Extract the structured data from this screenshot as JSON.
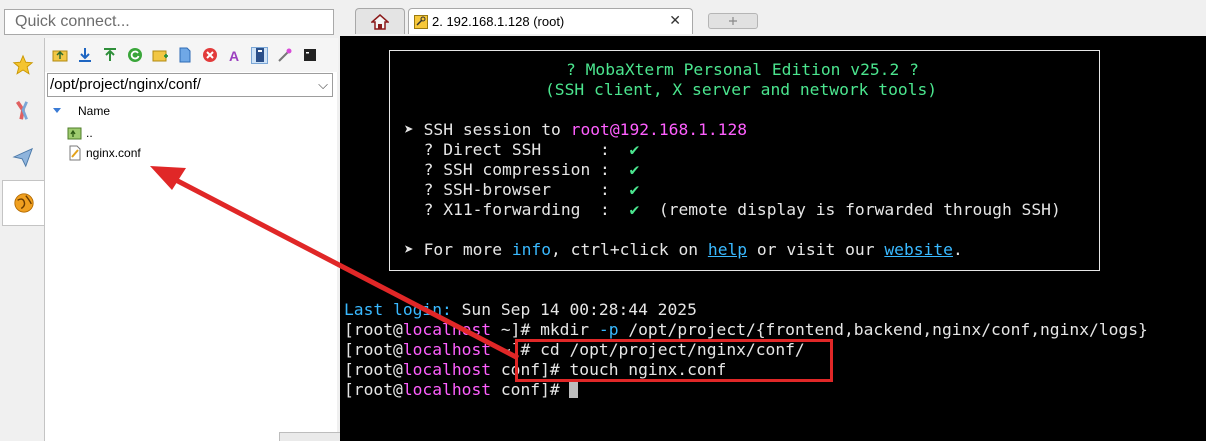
{
  "quick_connect": {
    "placeholder": "Quick connect..."
  },
  "side_tabs": [
    {
      "name": "favorites",
      "icon": "star-icon"
    },
    {
      "name": "tools",
      "icon": "tools-icon"
    },
    {
      "name": "sftp",
      "icon": "paper-plane-icon"
    },
    {
      "name": "sessions",
      "icon": "globe-icon"
    }
  ],
  "browser": {
    "toolbar_icons": [
      "parent-folder-icon",
      "download-icon",
      "upload-icon",
      "refresh-icon",
      "new-folder-icon",
      "new-file-icon",
      "delete-icon",
      "rename-icon",
      "follow-terminal-icon",
      "wand-icon",
      "terminal-icon"
    ],
    "path": "/opt/project/nginx/conf/",
    "column_name": "Name",
    "items": [
      {
        "label": "..",
        "icon": "parent-folder-icon"
      },
      {
        "label": "nginx.conf",
        "icon": "text-file-icon"
      }
    ]
  },
  "tabs": {
    "ssh_tab_label": "2. 192.168.1.128 (root)",
    "close_symbol": "✕"
  },
  "terminal": {
    "banner_title": "? MobaXterm Personal Edition v25.2 ?",
    "banner_subtitle": "(SSH client, X server and network tools)",
    "session_prefix": "➤ SSH session to ",
    "session_target": "root@192.168.1.128",
    "features": [
      {
        "label": "  ? Direct SSH      :  ",
        "value": "✔",
        "note": ""
      },
      {
        "label": "  ? SSH compression :  ",
        "value": "✔",
        "note": ""
      },
      {
        "label": "  ? SSH-browser     :  ",
        "value": "✔",
        "note": ""
      },
      {
        "label": "  ? X11-forwarding  :  ",
        "value": "✔",
        "note": "  (remote display is forwarded through SSH)"
      }
    ],
    "more_prefix": "➤ For more ",
    "more_info": "info",
    "more_mid": ", ctrl+click on ",
    "more_help": "help",
    "more_mid2": " or visit our ",
    "more_website": "website",
    "more_end": ".",
    "last_login_label": "Last login:",
    "last_login_value": " Sun Sep 14 00:28:44 2025",
    "prompts": [
      {
        "user": "[root@",
        "host": "localhost",
        "dir": " ~]# ",
        "cmd": "mkdir ",
        "flag": "-p",
        "args": " /opt/project/{frontend,backend,nginx/conf,nginx/logs}"
      },
      {
        "user": "[root@",
        "host": "localhost",
        "dir": " ~]# ",
        "cmd": "cd /opt/project/nginx/conf/",
        "flag": "",
        "args": ""
      },
      {
        "user": "[root@",
        "host": "localhost",
        "dir": " conf]# ",
        "cmd": "touch nginx.conf",
        "flag": "",
        "args": ""
      },
      {
        "user": "[root@",
        "host": "localhost",
        "dir": " conf]# ",
        "cmd": "",
        "flag": "",
        "args": ""
      }
    ]
  },
  "colors": {
    "annotation_red": "#e02727",
    "terminal_bg": "#000000",
    "prompt_host": "#ff5fff",
    "banner_green": "#4be58e"
  }
}
